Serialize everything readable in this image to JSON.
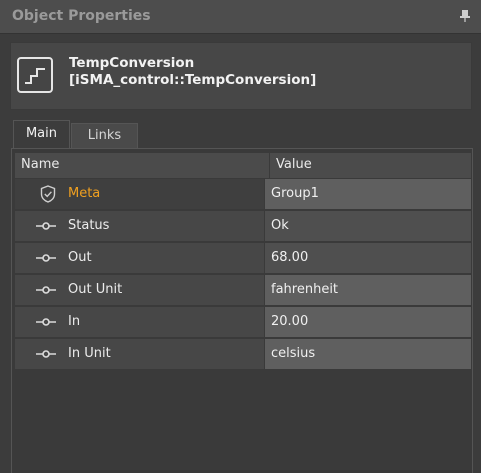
{
  "window": {
    "title": "Object Properties",
    "pin_icon": "pin-icon"
  },
  "object": {
    "name": "TempConversion",
    "type": "[iSMA_control::TempConversion]",
    "icon": "step-function-icon"
  },
  "tabs": [
    {
      "label": "Main",
      "active": true
    },
    {
      "label": "Links",
      "active": false
    }
  ],
  "grid": {
    "columns": {
      "name": "Name",
      "value": "Value"
    },
    "rows": [
      {
        "label": "Meta",
        "value": "Group1",
        "icon": "shield-icon"
      },
      {
        "label": "Status",
        "value": "Ok",
        "icon": "slot-icon"
      },
      {
        "label": "Out",
        "value": "68.00",
        "icon": "slot-icon"
      },
      {
        "label": "Out Unit",
        "value": "fahrenheit",
        "icon": "slot-icon"
      },
      {
        "label": "In",
        "value": "20.00",
        "icon": "slot-icon"
      },
      {
        "label": "In Unit",
        "value": "celsius",
        "icon": "slot-icon"
      }
    ]
  },
  "colors": {
    "meta_label": "#f0a020",
    "background": "#3c3c3c"
  }
}
